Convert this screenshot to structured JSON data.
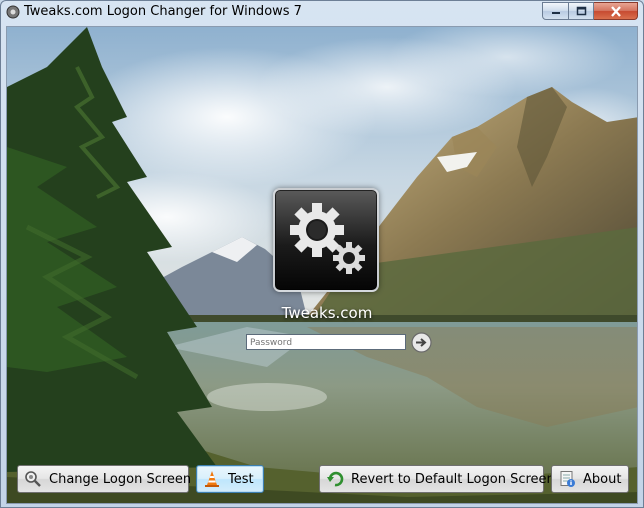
{
  "window": {
    "title": "Tweaks.com Logon Changer for Windows 7",
    "controls": {
      "minimize": "minimize",
      "maximize": "maximize",
      "close": "close"
    }
  },
  "preview": {
    "brand_text": "Tweaks.com",
    "password_placeholder": "Password"
  },
  "buttons": {
    "change": "Change Logon Screen",
    "test": "Test",
    "revert": "Revert to Default Logon Screen",
    "about": "About"
  },
  "icons": {
    "app": "gear-icon",
    "logo": "gears-icon",
    "arrow": "arrow-right-icon",
    "change": "magnifier-gear-icon",
    "test": "traffic-cone-icon",
    "revert": "undo-arrow-icon",
    "about": "info-document-icon"
  },
  "colors": {
    "title_close": "#c74a31",
    "focus_border": "#3c7fb1"
  }
}
